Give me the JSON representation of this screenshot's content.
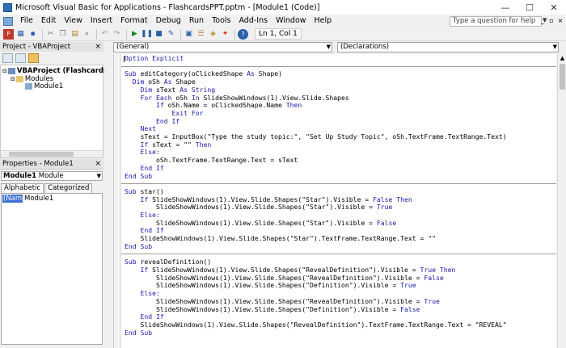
{
  "window": {
    "title": "Microsoft Visual Basic for Applications - FlashcardsPPT.pptm - [Module1 (Code)]",
    "minimize": "—",
    "maximize": "☐",
    "close": "✕"
  },
  "menu": {
    "items": [
      "File",
      "Edit",
      "View",
      "Insert",
      "Format",
      "Debug",
      "Run",
      "Tools",
      "Add-Ins",
      "Window",
      "Help"
    ],
    "help_placeholder": "Type a question for help",
    "mdi_min": "_",
    "mdi_restore": "▫",
    "mdi_close": "×"
  },
  "toolbar": {
    "position": "Ln 1, Col 1",
    "icons": [
      "excel-view-icon",
      "insert-module-icon",
      "save-icon",
      "cut-icon",
      "copy-icon",
      "paste-icon",
      "find-icon",
      "undo-icon",
      "redo-icon",
      "run-icon",
      "break-icon",
      "reset-icon",
      "design-mode-icon",
      "project-explorer-icon",
      "properties-icon",
      "object-browser-icon",
      "toolbox-icon",
      "help-icon"
    ]
  },
  "project_panel": {
    "title": "Project - VBAProject",
    "close": "×",
    "tree": {
      "project": "VBAProject (FlashcardsPPT.pp",
      "folder": "Modules",
      "module": "Module1"
    }
  },
  "properties_panel": {
    "title": "Properties - Module1",
    "close": "×",
    "combo_object": "Module1",
    "combo_type": "Module",
    "tabs": [
      "Alphabetic",
      "Categorized"
    ],
    "prop_name": "(Name)",
    "prop_value": "Module1"
  },
  "code_window": {
    "object_combo": "(General)",
    "proc_combo": "(Declarations)",
    "colors": {
      "keyword": "#1a1aa6",
      "text": "#000000"
    }
  }
}
